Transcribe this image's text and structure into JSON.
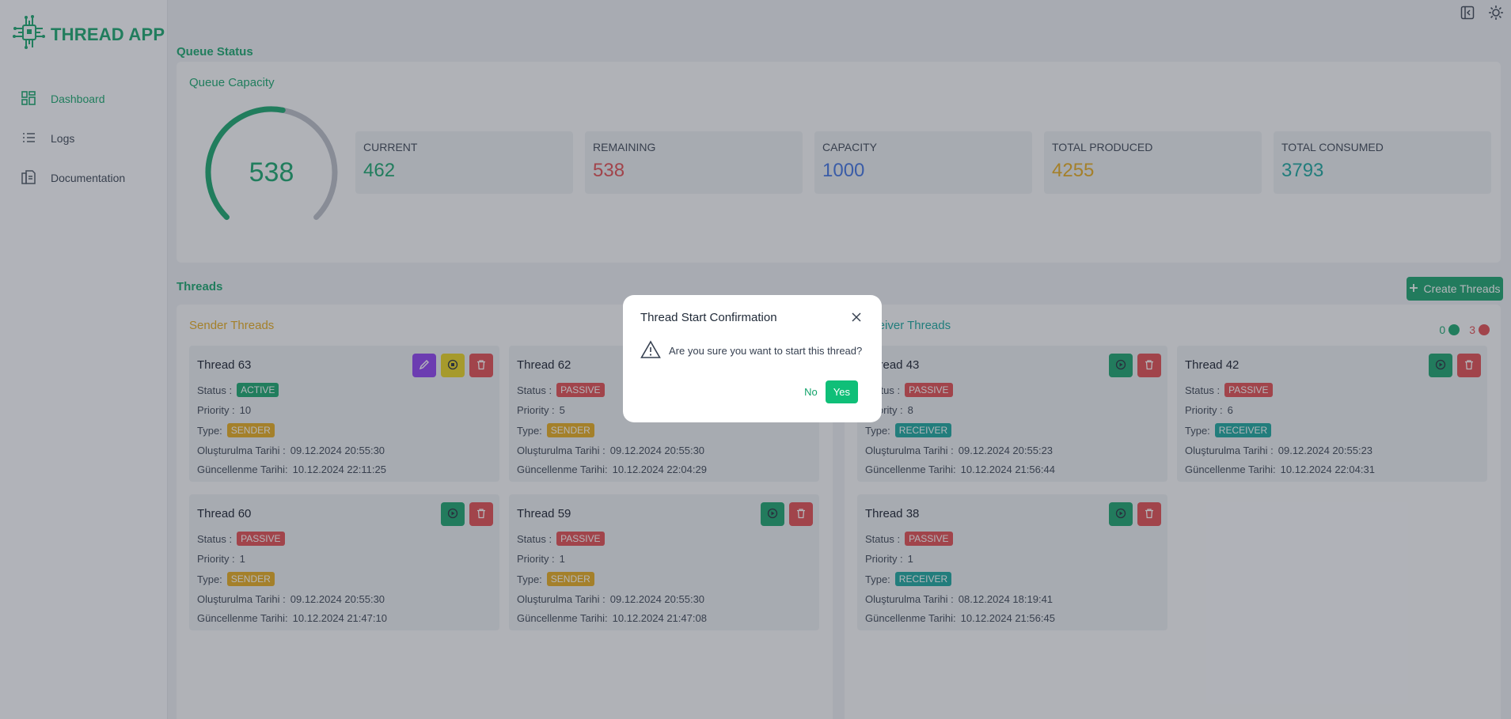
{
  "app": {
    "name": "THREAD APP"
  },
  "sidebar": {
    "items": [
      {
        "label": "Dashboard",
        "icon": "dashboard-icon",
        "active": true
      },
      {
        "label": "Logs",
        "icon": "list-icon"
      },
      {
        "label": "Documentation",
        "icon": "document-icon"
      }
    ]
  },
  "queue": {
    "section_title": "Queue Status",
    "panel_title": "Queue Capacity",
    "gauge_value": "538",
    "gauge_fraction": 0.538,
    "stats": [
      {
        "label": "CURRENT",
        "value": "462",
        "color": "#12a36a"
      },
      {
        "label": "REMAINING",
        "value": "538",
        "color": "#e0474c"
      },
      {
        "label": "CAPACITY",
        "value": "1000",
        "color": "#3b6fe0"
      },
      {
        "label": "TOTAL PRODUCED",
        "value": "4255",
        "color": "#e6a818"
      },
      {
        "label": "TOTAL CONSUMED",
        "value": "3793",
        "color": "#14a39b"
      }
    ]
  },
  "threads": {
    "section_title": "Threads",
    "create_label": "Create Threads",
    "sender_title": "Sender Threads",
    "receiver_title": "Receiver Threads",
    "receiver_counts": {
      "active": "0",
      "passive": "3"
    },
    "sender": [
      {
        "title": "Thread 63",
        "status": "ACTIVE",
        "priority": "10",
        "type": "SENDER",
        "created": "09.12.2024 20:55:30",
        "updated": "10.12.2024 22:11:25"
      },
      {
        "title": "Thread 62",
        "status": "PASSIVE",
        "priority": "5",
        "type": "SENDER",
        "created": "09.12.2024 20:55:30",
        "updated": "10.12.2024 22:04:29"
      },
      {
        "title": "Thread 60",
        "status": "PASSIVE",
        "priority": "1",
        "type": "SENDER",
        "created": "09.12.2024 20:55:30",
        "updated": "10.12.2024 21:47:10"
      },
      {
        "title": "Thread 59",
        "status": "PASSIVE",
        "priority": "1",
        "type": "SENDER",
        "created": "09.12.2024 20:55:30",
        "updated": "10.12.2024 21:47:08"
      }
    ],
    "receiver": [
      {
        "title": "Thread 43",
        "status": "PASSIVE",
        "priority": "8",
        "type": "RECEIVER",
        "created": "09.12.2024 20:55:23",
        "updated": "10.12.2024 21:56:44"
      },
      {
        "title": "Thread 42",
        "status": "PASSIVE",
        "priority": "6",
        "type": "RECEIVER",
        "created": "09.12.2024 20:55:23",
        "updated": "10.12.2024 22:04:31"
      },
      {
        "title": "Thread 38",
        "status": "PASSIVE",
        "priority": "1",
        "type": "RECEIVER",
        "created": "08.12.2024 18:19:41",
        "updated": "10.12.2024 21:56:45"
      }
    ],
    "labels": {
      "status": "Status :",
      "priority": "Priority :",
      "type": "Type:",
      "created": "Oluşturulma Tarihi :",
      "updated": "Güncellenme Tarihi:"
    }
  },
  "modal": {
    "title": "Thread Start Confirmation",
    "message": "Are you sure you want to start this thread?",
    "no_label": "No",
    "yes_label": "Yes"
  }
}
